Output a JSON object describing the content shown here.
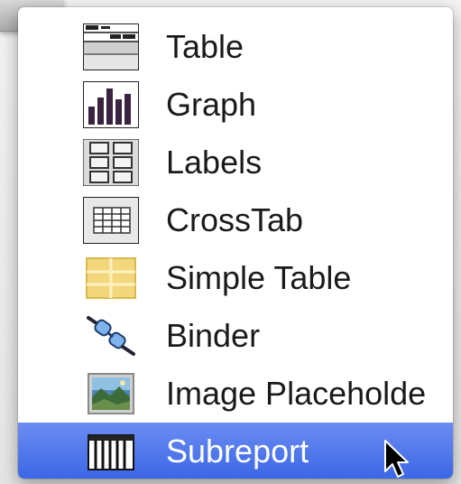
{
  "menu": {
    "items": [
      {
        "label": "Table",
        "icon": "table-icon",
        "selected": false
      },
      {
        "label": "Graph",
        "icon": "graph-icon",
        "selected": false
      },
      {
        "label": "Labels",
        "icon": "labels-icon",
        "selected": false
      },
      {
        "label": "CrossTab",
        "icon": "crosstab-icon",
        "selected": false
      },
      {
        "label": "Simple Table",
        "icon": "simple-table-icon",
        "selected": false
      },
      {
        "label": "Binder",
        "icon": "binder-icon",
        "selected": false
      },
      {
        "label": "Image Placeholde",
        "icon": "image-placeholder-icon",
        "selected": false
      },
      {
        "label": "Subreport",
        "icon": "subreport-icon",
        "selected": true
      }
    ],
    "highlight_color": "#3a66e5"
  },
  "cursor": {
    "icon": "mouse-pointer-icon"
  }
}
